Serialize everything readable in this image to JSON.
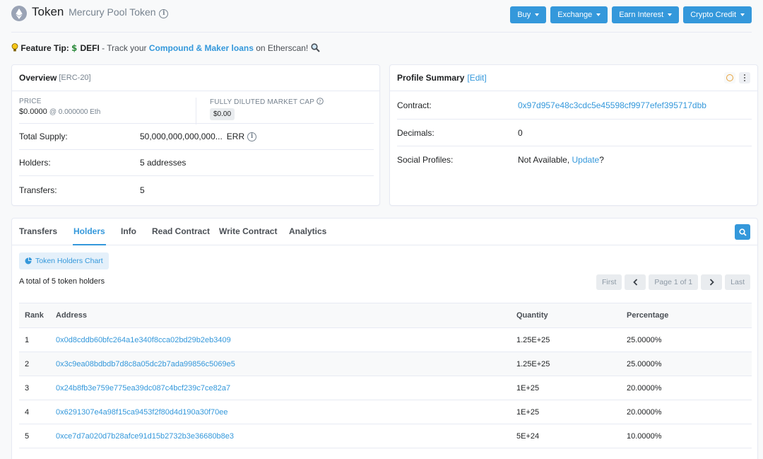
{
  "header": {
    "title": "Token",
    "subtitle": "Mercury Pool Token",
    "info_glyph": "i",
    "buttons": [
      {
        "label": "Buy"
      },
      {
        "label": "Exchange"
      },
      {
        "label": "Earn Interest"
      },
      {
        "label": "Crypto Credit"
      }
    ]
  },
  "feature_tip": {
    "label": "Feature Tip:",
    "defi": "DEFI",
    "text1": " - Track your ",
    "link": "Compound & Maker loans",
    "text2": " on Etherscan!"
  },
  "overview": {
    "title": "Overview",
    "standard": "[ERC-20]",
    "price_label": "PRICE",
    "price_value": "$0.0000",
    "price_eth": "@ 0.000000 Eth",
    "cap_label": "FULLY DILUTED MARKET CAP",
    "cap_value": "$0.00",
    "rows": [
      {
        "label": "Total Supply:",
        "value": "50,000,000,000,000...",
        "extra": "ERR"
      },
      {
        "label": "Holders:",
        "value": "5 addresses"
      },
      {
        "label": "Transfers:",
        "value": "5"
      }
    ]
  },
  "profile": {
    "title": "Profile Summary",
    "edit": "[Edit]",
    "rows": [
      {
        "label": "Contract:",
        "value": "0x97d957e48c3cdc5e45598cf9977efef395717dbb"
      },
      {
        "label": "Decimals:",
        "value": "0"
      },
      {
        "label": "Social Profiles:",
        "value": "Not Available,",
        "link": "Update",
        "suffix": " ?"
      }
    ]
  },
  "tabs": [
    {
      "label": "Transfers"
    },
    {
      "label": "Holders"
    },
    {
      "label": "Info"
    },
    {
      "label": "Read Contract"
    },
    {
      "label": "Write Contract"
    },
    {
      "label": "Analytics"
    }
  ],
  "holders": {
    "chart_button": "Token Holders Chart",
    "total_text": "A total of 5 token holders",
    "pager": {
      "first": "First",
      "page": "Page 1 of 1",
      "last": "Last"
    },
    "columns": {
      "rank": "Rank",
      "address": "Address",
      "quantity": "Quantity",
      "percentage": "Percentage"
    },
    "rows": [
      {
        "rank": "1",
        "address": "0x0d8cddb60bfc264a1e340f8cca02bd29b2eb3409",
        "quantity": "1.25E+25",
        "percentage": "25.0000%"
      },
      {
        "rank": "2",
        "address": "0x3c9ea08bdbdb7d8c8a05dc2b7ada99856c5069e5",
        "quantity": "1.25E+25",
        "percentage": "25.0000%"
      },
      {
        "rank": "3",
        "address": "0x24b8fb3e759e775ea39dc087c4bcf239c7ce82a7",
        "quantity": "1E+25",
        "percentage": "20.0000%"
      },
      {
        "rank": "4",
        "address": "0x6291307e4a98f15ca9453f2f80d4d190a30f70ee",
        "quantity": "1E+25",
        "percentage": "20.0000%"
      },
      {
        "rank": "5",
        "address": "0xce7d7a020d7b28afce91d15b2732b3e36680b8e3",
        "quantity": "5E+24",
        "percentage": "10.0000%"
      }
    ]
  },
  "colors": {
    "accent": "#3498db",
    "border": "#e7eaf3",
    "muted_text": "#77838f"
  },
  "icons": [
    "ethereum-logo-icon",
    "info-icon",
    "chevron-down-icon",
    "lightbulb-icon",
    "dollar-icon",
    "magnifier-icon",
    "question-circle-icon",
    "circle-icon",
    "more-vertical-icon",
    "search-icon",
    "pie-chart-icon",
    "chevron-left-icon",
    "chevron-right-icon"
  ]
}
